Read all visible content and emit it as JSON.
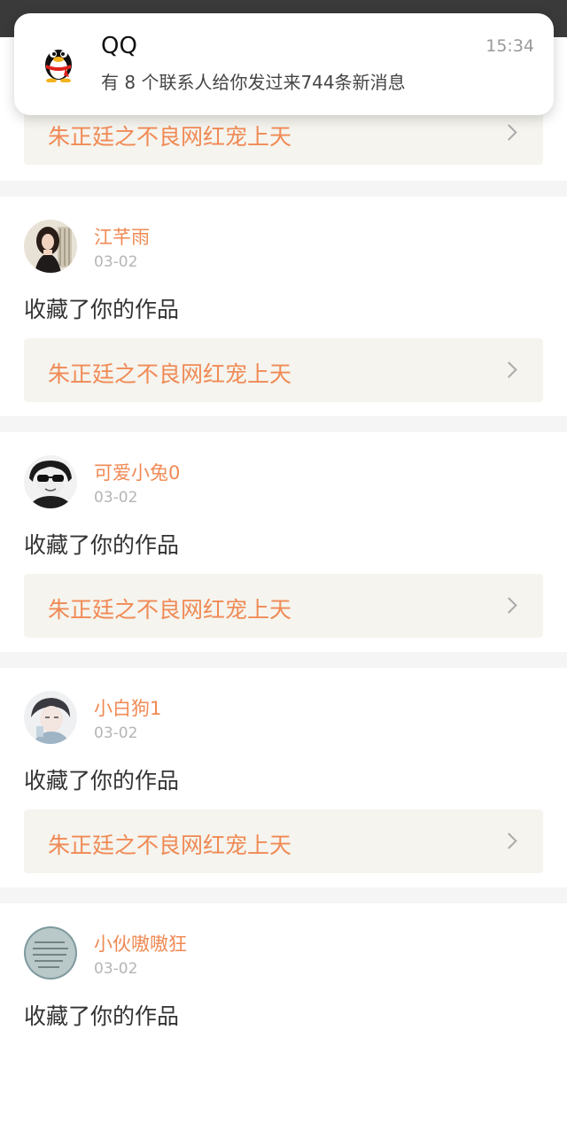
{
  "notification": {
    "app_name": "QQ",
    "time": "15:34",
    "message": "有 8 个联系人给你发过来744条新消息",
    "icon": "qq-penguin-icon"
  },
  "feed": {
    "first_card": {
      "work_title": "朱正廷之不良网红宠上天"
    },
    "items": [
      {
        "name": "江芊雨",
        "date": "03-02",
        "action": "收藏了你的作品",
        "work_title": "朱正廷之不良网红宠上天"
      },
      {
        "name": "可爱小兔0",
        "date": "03-02",
        "action": "收藏了你的作品",
        "work_title": "朱正廷之不良网红宠上天"
      },
      {
        "name": "小白狗1",
        "date": "03-02",
        "action": "收藏了你的作品",
        "work_title": "朱正廷之不良网红宠上天"
      },
      {
        "name": "小伙嗷嗷狂",
        "date": "03-02",
        "action": "收藏了你的作品"
      }
    ]
  },
  "colors": {
    "accent": "#f08a55",
    "link_bg": "#f5f4ee",
    "date": "#b5b5b5",
    "body_text": "#333333"
  }
}
